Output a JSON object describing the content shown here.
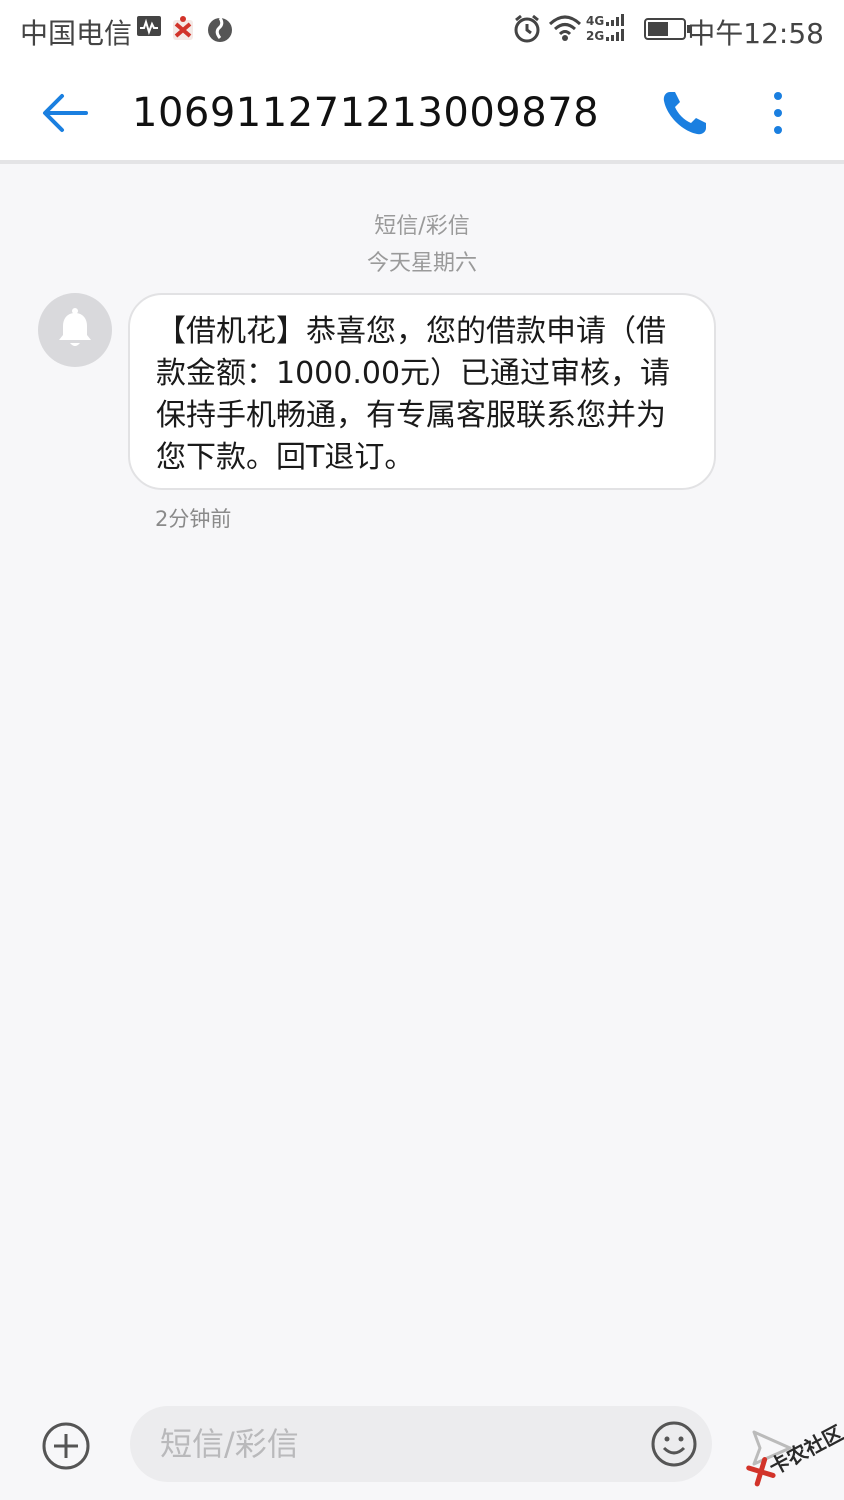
{
  "status_bar": {
    "carrier": "中国电信",
    "time": "中午12:58",
    "network_label_top": "4G",
    "network_label_bottom": "2G"
  },
  "header": {
    "title": "106911271213009878"
  },
  "conversation": {
    "type_label": "短信/彩信",
    "date_label": "今天星期六",
    "messages": [
      {
        "text": "【借机花】恭喜您，您的借款申请（借款金额：1000.00元）已通过审核，请保持手机畅通，有专属客服联系您并为您下款。回T退订。",
        "time": "2分钟前"
      }
    ]
  },
  "composer": {
    "placeholder": "短信/彩信"
  },
  "watermark": {
    "text": "卡农社区"
  },
  "colors": {
    "accent": "#1a7fe0",
    "background": "#f7f7f9",
    "bubble": "#ffffff",
    "avatar": "#d9d9dc"
  },
  "icons": {
    "back": "arrow-left-icon",
    "call": "phone-icon",
    "more": "more-vert-icon",
    "avatar": "bell-icon",
    "add": "plus-circle-icon",
    "emoji": "smiley-icon",
    "send": "send-icon"
  }
}
